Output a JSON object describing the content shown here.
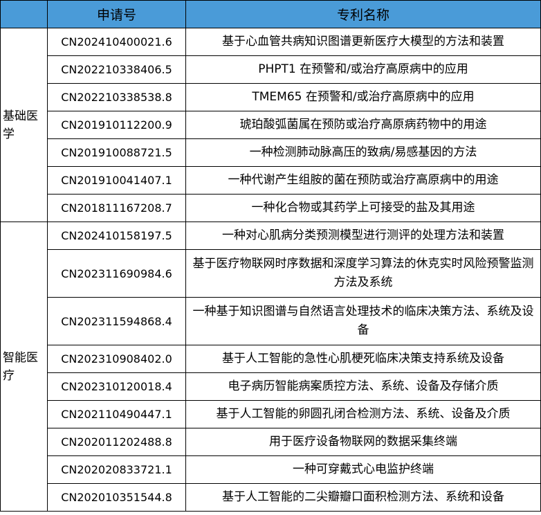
{
  "header": {
    "number": "申请号",
    "name": "专利名称"
  },
  "groups": [
    {
      "category": "基础医学",
      "rows": [
        {
          "number": "CN202410400021.6",
          "name": "基于心血管共病知识图谱更新医疗大模型的方法和装置"
        },
        {
          "number": "CN202210338406.5",
          "name": "PHPT1 在预警和/或治疗高原病中的应用"
        },
        {
          "number": "CN202210338538.8",
          "name": "TMEM65 在预警和/或治疗高原病中的应用"
        },
        {
          "number": "CN201910112200.9",
          "name": "琥珀酸弧菌属在预防或治疗高原病药物中的用途"
        },
        {
          "number": "CN201910088721.5",
          "name": "一种检测肺动脉高压的致病/易感基因的方法"
        },
        {
          "number": "CN201910041407.1",
          "name": "一种代谢产生组胺的菌在预防或治疗高原病中的用途"
        },
        {
          "number": "CN201811167208.7",
          "name": "一种化合物或其药学上可接受的盐及其用途"
        }
      ]
    },
    {
      "category": "智能医疗",
      "rows": [
        {
          "number": "CN202410158197.5",
          "name": "一种对心肌病分类预测模型进行测评的处理方法和装置"
        },
        {
          "number": "CN202311690984.6",
          "name": "基于医疗物联网时序数据和深度学习算法的休克实时风险预警监测方法及系统"
        },
        {
          "number": "CN202311594868.4",
          "name": "一种基于知识图谱与自然语言处理技术的临床决策方法、系统及设备"
        },
        {
          "number": "CN202310908402.0",
          "name": "基于人工智能的急性心肌梗死临床决策支持系统及设备"
        },
        {
          "number": "CN202310120018.4",
          "name": "电子病历智能病案质控方法、系统、设备及存储介质"
        },
        {
          "number": "CN202110490447.1",
          "name": "基于人工智能的卵圆孔闭合检测方法、系统、设备及介质"
        },
        {
          "number": "CN202011202488.8",
          "name": "用于医疗设备物联网的数据采集终端"
        },
        {
          "number": "CN202020833721.1",
          "name": "一种可穿戴式心电监护终端"
        },
        {
          "number": "CN202010351544.8",
          "name": "基于人工智能的二尖瓣瓣口面积检测方法、系统和设备"
        }
      ]
    }
  ]
}
